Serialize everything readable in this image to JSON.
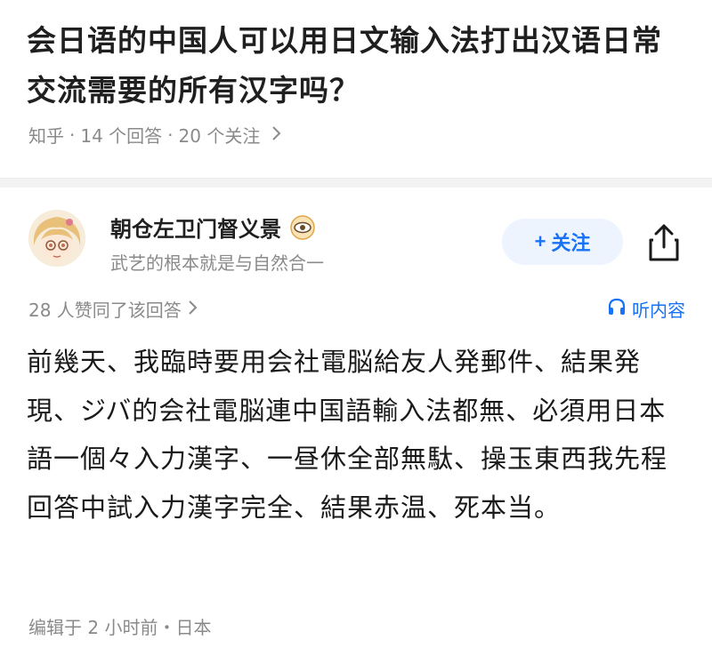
{
  "question": {
    "title": "会日语的中国人可以用日文输入法打出汉语日常交流需要的所有汉字吗？",
    "source": "知乎",
    "answers_count": "14 个回答",
    "followers_count": "20 个关注",
    "separator": "·"
  },
  "author": {
    "name": "朝仓左卫门督义景",
    "signature": "武艺的根本就是与自然合一",
    "follow_label": "关注",
    "follow_plus": "+"
  },
  "answer": {
    "upvote_text": "28 人赞同了该回答",
    "listen_label": "听内容",
    "body": "前幾天、我臨時要用会社電脳給友人発郵件、結果発現、ジバ的会社電脳連中国語輸入法都無、必須用日本語一個々入力漢字、一昼休全部無駄、操玉東西我先程回答中試入力漢字完全、結果赤温、死本当。",
    "edit_meta": "编辑于 2 小时前・日本"
  },
  "colors": {
    "accent": "#1772f6",
    "muted": "#8a8a8a",
    "follow_bg": "#eef4fd"
  },
  "icons": {
    "badge": "eye-badge-icon",
    "share": "share-icon",
    "listen": "headphones-icon",
    "chevron": "chevron-right-icon"
  }
}
